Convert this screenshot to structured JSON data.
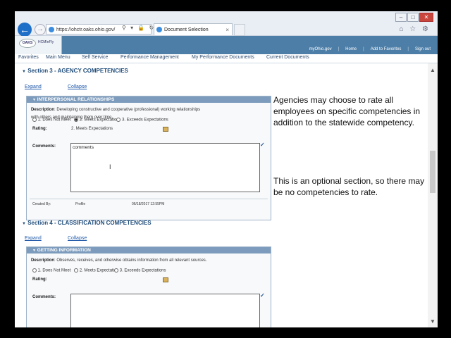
{
  "browser": {
    "address": "https://ohctr.oaks.ohio.gov/",
    "tab_title": "Document Selection",
    "tab_close": "×",
    "address_tools": "⚲ ▾ 🔒 ↻",
    "window_controls": [
      "–",
      "□",
      "✕"
    ],
    "right_icons": "⌂ ☆ ⚙"
  },
  "header": {
    "logo_text": "OAKS",
    "app_name": "HCM/eFly",
    "links": [
      "myOhio.gov",
      "Home",
      "Add to Favorites",
      "Sign out"
    ]
  },
  "menu": [
    "Favorites",
    "Main Menu",
    "Self Service",
    "Performance Management",
    "My Performance Documents",
    "Current Documents"
  ],
  "section3": {
    "title": "Section 3 - AGENCY COMPETENCIES",
    "expand": "Expand",
    "collapse": "Collapse",
    "panel": {
      "heading": "INTERPERSONAL RELATIONSHIPS",
      "description_label": "Description",
      "description": ": Developing constructive and cooperative (professional) working relationships with others and maintaining them over time.",
      "options": [
        "1. Does Not Meet",
        "2. Meets Expectatio",
        "3. Exceeds Expectations"
      ],
      "rating_label": "Rating:",
      "rating_value": "2. Meets Expectations",
      "comments_label": "Comments:",
      "comments_value": "comments",
      "created_by_label": "Created By:",
      "created_by_value": "Profile",
      "created_date": "06/18/2017 12:55PM"
    }
  },
  "section4": {
    "title": "Section 4 - CLASSIFICATION COMPETENCIES",
    "expand": "Expand",
    "collapse": "Collapse",
    "panel": {
      "heading": "GETTING INFORMATION",
      "description_label": "Description",
      "description": ": Observes, receives, and otherwise obtains information from all relevant sources.",
      "options": [
        "1. Does Not Meet",
        "2. Meets Expectati",
        "3. Exceeds Expectations"
      ],
      "rating_label": "Rating:",
      "comments_label": "Comments:"
    }
  },
  "notes": {
    "note1": "Agencies may choose to rate all employees on specific competencies in addition to the statewide competency.",
    "note2": "This is an optional section, so there may be no competencies to rate."
  },
  "icons": {
    "collapse_arrow": "▼",
    "back": "←",
    "forward": "→",
    "spellcheck": "✓",
    "scroll_up": "▲",
    "scroll_down": "▼"
  }
}
